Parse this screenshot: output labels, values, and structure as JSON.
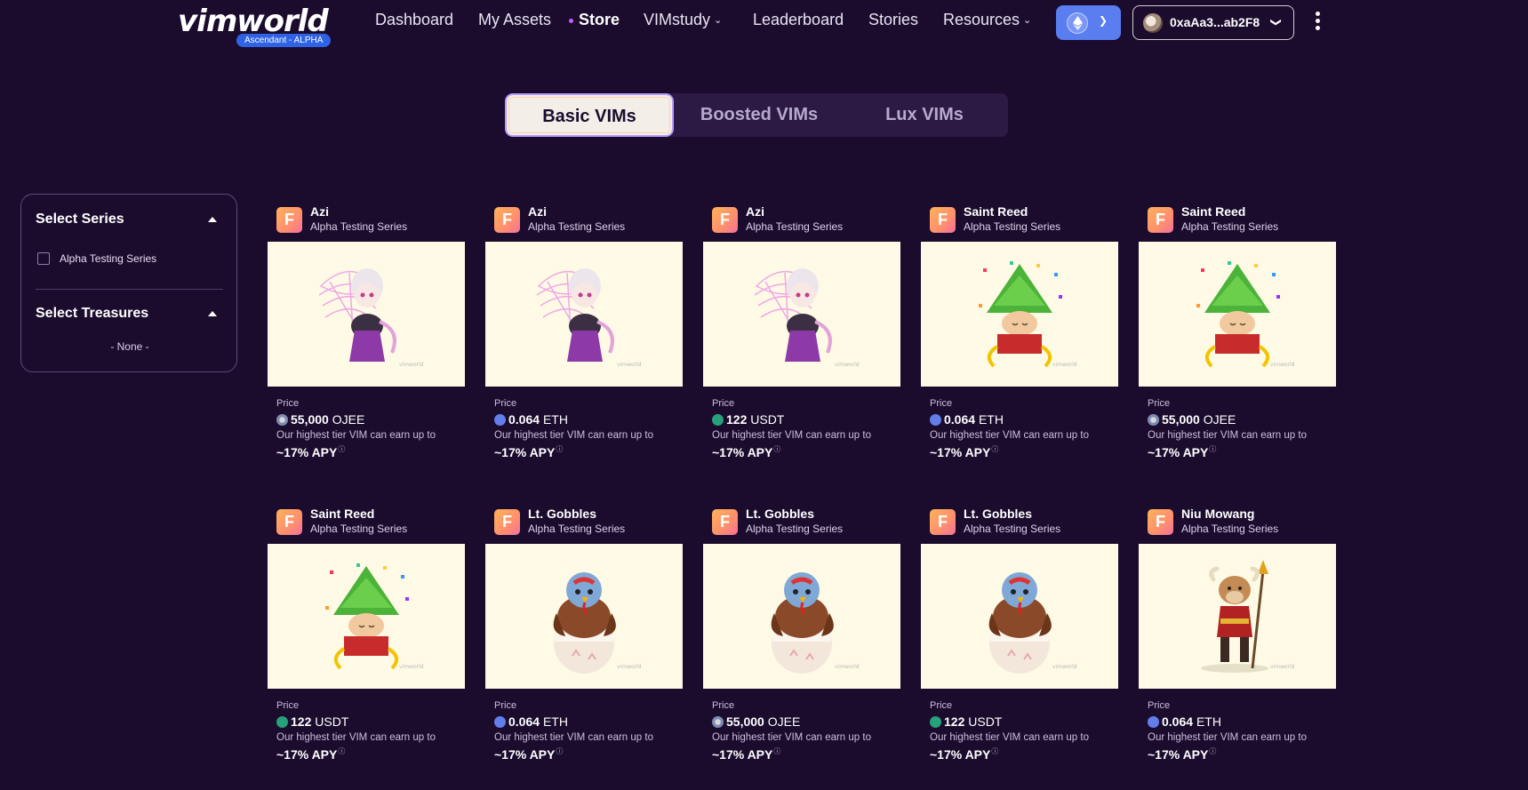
{
  "header": {
    "logo_text": "vimworld",
    "logo_badge": "Ascendant - ALPHA",
    "nav": [
      {
        "label": "Dashboard"
      },
      {
        "label": "My Assets"
      },
      {
        "label": "Store"
      },
      {
        "label": "VIMstudy"
      },
      {
        "label": "Leaderboard"
      },
      {
        "label": "Stories"
      },
      {
        "label": "Resources"
      }
    ],
    "active_nav": "Store",
    "wallet_address": "0xaAa3...ab2F8"
  },
  "tabs": [
    {
      "label": "Basic VIMs",
      "active": true
    },
    {
      "label": "Boosted VIMs",
      "active": false
    },
    {
      "label": "Lux VIMs",
      "active": false
    }
  ],
  "sidebar": {
    "series_title": "Select Series",
    "series_options": [
      {
        "label": "Alpha Testing Series",
        "checked": false
      }
    ],
    "treasures_title": "Select Treasures",
    "treasures_empty": "- None -"
  },
  "cards": [
    {
      "tier": "F",
      "name": "Azi",
      "series": "Alpha Testing Series",
      "character": "azi",
      "price_label": "Price",
      "price": "55,000",
      "currency": "OJEE",
      "note": "Our highest tier VIM can earn up to",
      "apy": "~17% APY"
    },
    {
      "tier": "F",
      "name": "Azi",
      "series": "Alpha Testing Series",
      "character": "azi",
      "price_label": "Price",
      "price": "0.064",
      "currency": "ETH",
      "note": "Our highest tier VIM can earn up to",
      "apy": "~17% APY"
    },
    {
      "tier": "F",
      "name": "Azi",
      "series": "Alpha Testing Series",
      "character": "azi",
      "price_label": "Price",
      "price": "122",
      "currency": "USDT",
      "note": "Our highest tier VIM can earn up to",
      "apy": "~17% APY"
    },
    {
      "tier": "F",
      "name": "Saint Reed",
      "series": "Alpha Testing Series",
      "character": "saint-reed",
      "price_label": "Price",
      "price": "0.064",
      "currency": "ETH",
      "note": "Our highest tier VIM can earn up to",
      "apy": "~17% APY"
    },
    {
      "tier": "F",
      "name": "Saint Reed",
      "series": "Alpha Testing Series",
      "character": "saint-reed",
      "price_label": "Price",
      "price": "55,000",
      "currency": "OJEE",
      "note": "Our highest tier VIM can earn up to",
      "apy": "~17% APY"
    },
    {
      "tier": "F",
      "name": "Saint Reed",
      "series": "Alpha Testing Series",
      "character": "saint-reed",
      "price_label": "Price",
      "price": "122",
      "currency": "USDT",
      "note": "Our highest tier VIM can earn up to",
      "apy": "~17% APY"
    },
    {
      "tier": "F",
      "name": "Lt. Gobbles",
      "series": "Alpha Testing Series",
      "character": "lt-gobbles",
      "price_label": "Price",
      "price": "0.064",
      "currency": "ETH",
      "note": "Our highest tier VIM can earn up to",
      "apy": "~17% APY"
    },
    {
      "tier": "F",
      "name": "Lt. Gobbles",
      "series": "Alpha Testing Series",
      "character": "lt-gobbles",
      "price_label": "Price",
      "price": "55,000",
      "currency": "OJEE",
      "note": "Our highest tier VIM can earn up to",
      "apy": "~17% APY"
    },
    {
      "tier": "F",
      "name": "Lt. Gobbles",
      "series": "Alpha Testing Series",
      "character": "lt-gobbles",
      "price_label": "Price",
      "price": "122",
      "currency": "USDT",
      "note": "Our highest tier VIM can earn up to",
      "apy": "~17% APY"
    },
    {
      "tier": "F",
      "name": "Niu Mowang",
      "series": "Alpha Testing Series",
      "character": "niu-mowang",
      "price_label": "Price",
      "price": "0.064",
      "currency": "ETH",
      "note": "Our highest tier VIM can earn up to",
      "apy": "~17% APY"
    }
  ],
  "colors": {
    "background": "#1b0c2e",
    "network_button": "#5a7df0",
    "card_image_bg": "#fefae5",
    "tier_badge": "#ff8f6e"
  }
}
